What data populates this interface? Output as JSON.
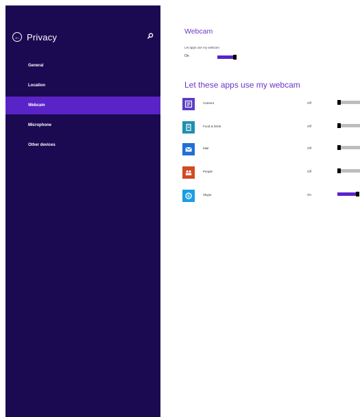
{
  "sidebar": {
    "title": "Privacy",
    "items": [
      {
        "label": "General",
        "active": false
      },
      {
        "label": "Location",
        "active": false
      },
      {
        "label": "Webcam",
        "active": true
      },
      {
        "label": "Microphone",
        "active": false
      },
      {
        "label": "Other devices",
        "active": false
      }
    ]
  },
  "main": {
    "section_title": "Webcam",
    "toggle_label": "Let apps use my webcam",
    "toggle_state": "On",
    "apps_title": "Let these apps use my webcam",
    "apps": [
      {
        "name": "Camera",
        "state": "Off",
        "icon": "camera-icon",
        "color": "#5b3cc4"
      },
      {
        "name": "Food & Drink",
        "state": "Off",
        "icon": "food-drink-icon",
        "color": "#1f8fb0"
      },
      {
        "name": "Mail",
        "state": "Off",
        "icon": "mail-icon",
        "color": "#1f6fd6"
      },
      {
        "name": "People",
        "state": "Off",
        "icon": "people-icon",
        "color": "#d44a25"
      },
      {
        "name": "Skype",
        "state": "On",
        "icon": "skype-icon",
        "color": "#1a9ee6"
      }
    ]
  },
  "colors": {
    "sidebar_bg": "#1b0a52",
    "accent": "#5a23c8",
    "heading": "#6a35c9"
  }
}
